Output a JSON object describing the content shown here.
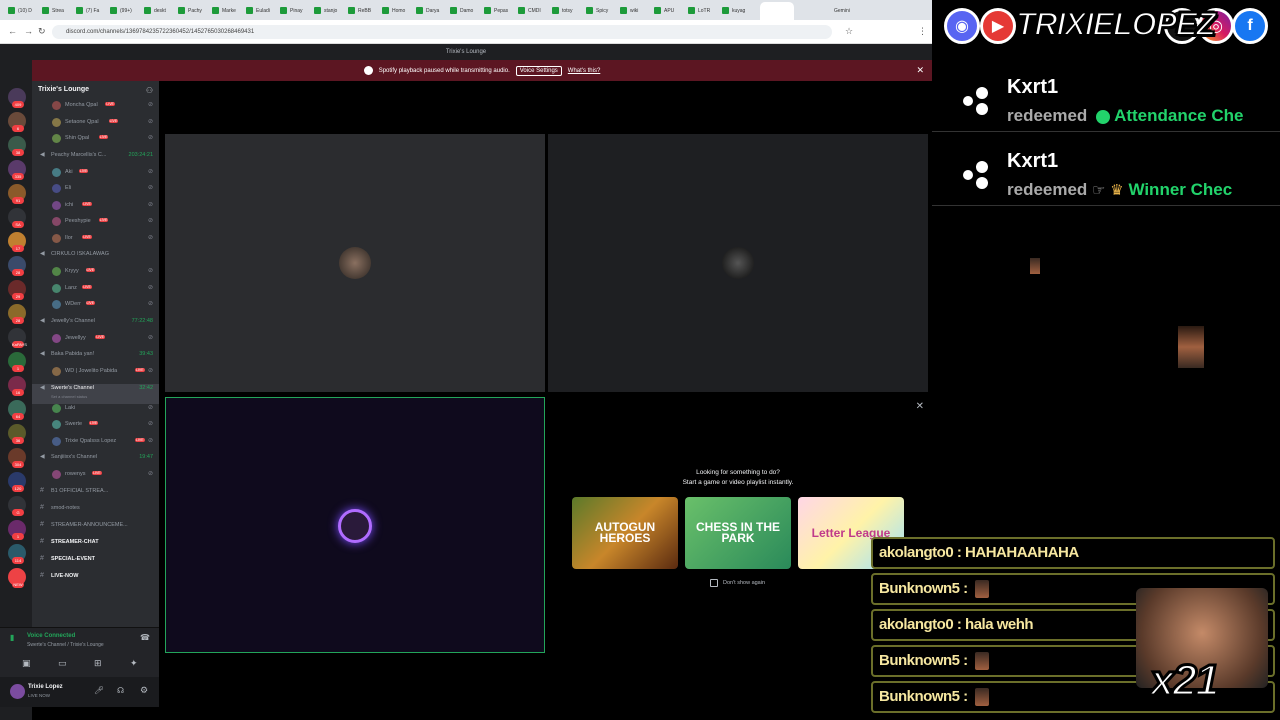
{
  "browser": {
    "tabs": [
      "(10) D",
      "Strea",
      "(7) Fa",
      "(99+)",
      "deskt",
      "Pachy",
      "Marke",
      "Euladi",
      "Pinay",
      "stanjo",
      "ReBB",
      "Homo",
      "Darya",
      "Damo",
      "Pepas",
      "CMDI",
      "totsy",
      "Spicy",
      "wiki",
      "APU",
      "LoTR",
      "kuyag"
    ],
    "active_tab": "",
    "gemini_tab": "Gemini",
    "url": "discord.com/channels/1369784235722360452/1452765030268469431"
  },
  "discord": {
    "title_bar": "Trixie's Lounge",
    "banner_text": "Spotify playback paused while transmitting audio.",
    "banner_button": "Voice Settings",
    "banner_link": "What's this?",
    "server_name": "Trixie's Lounge",
    "server_badges": [
      "409",
      "6",
      "38",
      "335",
      "91",
      "SA",
      "17",
      "28",
      "29",
      "28",
      "KaPAYS",
      "1",
      "16",
      "64",
      "36",
      "304",
      "120",
      "G",
      "1",
      "114",
      "NEW"
    ],
    "rows": [
      {
        "type": "user",
        "name": "Moncha Qpal",
        "live": true
      },
      {
        "type": "user",
        "name": "Setaone Qpal",
        "live": true
      },
      {
        "type": "user",
        "name": "Shin Qpal",
        "live": true
      },
      {
        "type": "vc",
        "name": "Peachy Marcellis's C...",
        "time": "203:24:21"
      },
      {
        "type": "user",
        "name": "Aki",
        "live": true
      },
      {
        "type": "user",
        "name": "Eli",
        "live": false
      },
      {
        "type": "user",
        "name": "ichi",
        "live": true
      },
      {
        "type": "user",
        "name": "Peeshypie",
        "live": true
      },
      {
        "type": "user",
        "name": "Ilor",
        "live": true
      },
      {
        "type": "vc",
        "name": "CIRKULO ISKALAWAG",
        "time": ""
      },
      {
        "type": "user",
        "name": "Kryyy",
        "live": true
      },
      {
        "type": "user",
        "name": "Lanz",
        "live": true
      },
      {
        "type": "user",
        "name": "WDerr",
        "live": true
      },
      {
        "type": "vc",
        "name": "Jewelly's Channel",
        "time": "77:22:48"
      },
      {
        "type": "user",
        "name": "Jewellyy",
        "live": true
      },
      {
        "type": "vc",
        "name": "Baka Pabida yan!",
        "time": "39:43"
      },
      {
        "type": "user",
        "name": "WD | Jowelito Pabida",
        "live": true
      },
      {
        "type": "vc",
        "name": "Swerte's Channel",
        "time": "32:42",
        "selected": true
      },
      {
        "type": "user",
        "name": "Laki",
        "live": false
      },
      {
        "type": "user",
        "name": "Swerte",
        "live": true
      },
      {
        "type": "user",
        "name": "Trixie Qpalsss Lopez",
        "live": true
      },
      {
        "type": "vc",
        "name": "Sanjiiixx's Channel",
        "time": "19:47"
      },
      {
        "type": "user",
        "name": "rowenys",
        "live": true
      },
      {
        "type": "tc",
        "name": "B1 OFFICIAL STREA..."
      },
      {
        "type": "tc",
        "name": "smod-notes"
      },
      {
        "type": "tc",
        "name": "STREAMER-ANNOUNCEME..."
      },
      {
        "type": "tc",
        "name": "STREAMER-CHAT"
      },
      {
        "type": "tc",
        "name": "SPECIAL-EVENT"
      },
      {
        "type": "tc",
        "name": "LIVE-NOW"
      }
    ],
    "live_label": "LIVE",
    "status_text": "Set a channel status",
    "voice_connected": "Voice Connected",
    "voice_location": "Swerte's Channel / Trixie's Lounge",
    "user_name": "Trixie Lopez",
    "user_status": "LIVE NOW",
    "activity_heading": "Looking for something to do?",
    "activity_sub": "Start a game or video playlist instantly.",
    "games": [
      "AUTOGUN HEROES",
      "CHESS IN THE PARK",
      "Letter League"
    ],
    "dont_show": "Don't show again"
  },
  "overlay": {
    "brand": "TRIXIELOPEZ",
    "redeems": [
      {
        "user": "Kxrt1",
        "verb": "redeemed",
        "reward": "Attendance Che"
      },
      {
        "user": "Kxrt1",
        "verb": "redeemed",
        "reward": "Winner Chec"
      }
    ],
    "chat": [
      {
        "user": "akolangto0",
        "msg": "HAHAHAAHAHA"
      },
      {
        "user": "Bunknown5",
        "msg": ""
      },
      {
        "user": "akolangto0",
        "msg": "hala wehh"
      },
      {
        "user": "Bunknown5",
        "msg": ""
      },
      {
        "user": "Bunknown5",
        "msg": ""
      }
    ],
    "combo": "x21"
  },
  "colors": {
    "accent": "#23a55a",
    "banner": "#5c1622",
    "discord_bg": "#2b2d31"
  }
}
